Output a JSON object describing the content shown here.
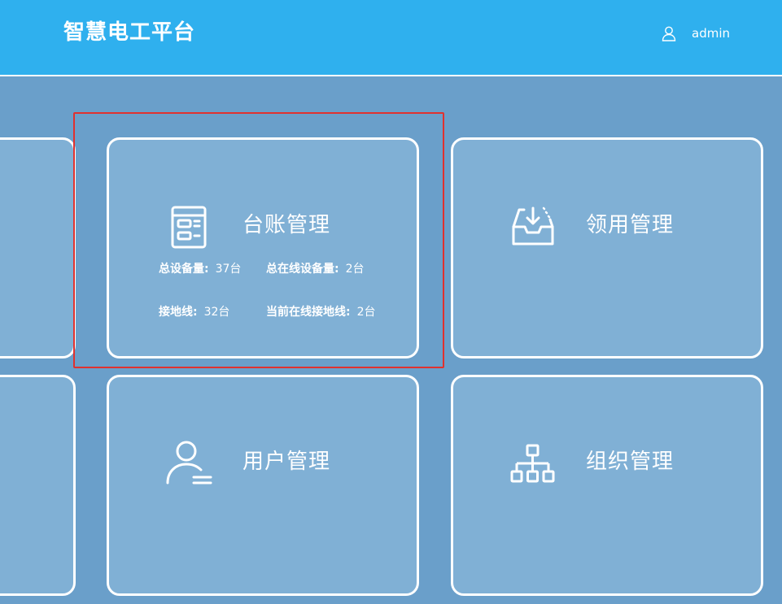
{
  "header": {
    "title": "智慧电工平台",
    "username": "admin"
  },
  "cards": {
    "ledger": {
      "title": "台账管理",
      "stats": [
        {
          "label": "总设备量:",
          "value": "37台"
        },
        {
          "label": "总在线设备量:",
          "value": "2台"
        },
        {
          "label": "接地线:",
          "value": "32台"
        },
        {
          "label": "当前在线接地线:",
          "value": "2台"
        }
      ]
    },
    "requisition": {
      "title": "领用管理"
    },
    "user": {
      "title": "用户管理"
    },
    "organization": {
      "title": "组织管理"
    }
  },
  "colors": {
    "header_bg": "#2fb0ee",
    "page_bg": "#6a9fca",
    "card_bg": "#80b0d5",
    "highlight": "#e0312f"
  }
}
